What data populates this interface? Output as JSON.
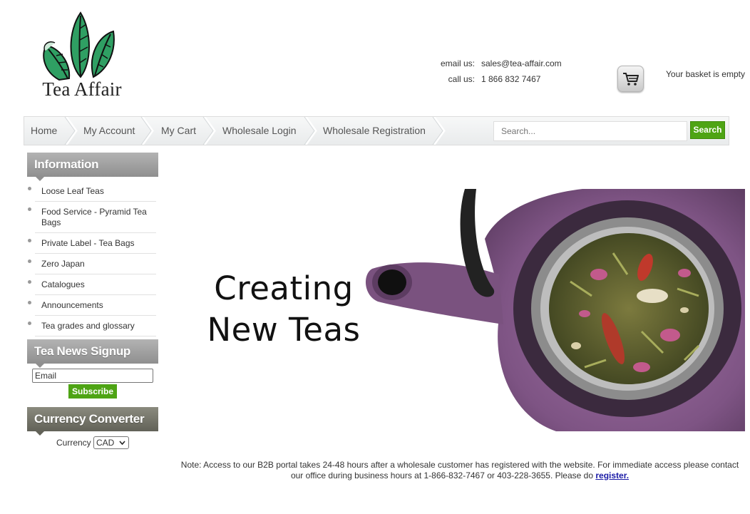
{
  "header": {
    "logo_text": "Tea Affair",
    "contact": [
      {
        "label": "email us:",
        "value": "sales@tea-affair.com"
      },
      {
        "label": "call us:",
        "value": "1 866 832 7467"
      }
    ],
    "basket_status": "Your basket is empty"
  },
  "nav": {
    "items": [
      "Home",
      "My Account",
      "My Cart",
      "Wholesale Login",
      "Wholesale Registration"
    ],
    "search_placeholder": "Search...",
    "search_button": "Search"
  },
  "sidebar": {
    "information": {
      "title": "Information",
      "items": [
        "Loose Leaf Teas",
        "Food Service - Pyramid Tea Bags",
        "Private Label - Tea Bags",
        "Zero Japan",
        "Catalogues",
        "Announcements",
        "Tea grades and glossary"
      ]
    },
    "newsletter": {
      "title": "Tea News Signup",
      "email_value": "Email",
      "subscribe_label": "Subscribe"
    },
    "currency": {
      "title": "Currency Converter",
      "label": "Currency",
      "selected": "CAD"
    }
  },
  "banner": {
    "line1": "Creating",
    "line2": "New Teas"
  },
  "note": {
    "text": "Note: Access to our B2B portal takes 24-48 hours after a wholesale customer has registered with the website. For immediate access please contact our office during business hours at 1-866-832-7467 or 403-228-3655. Please do ",
    "link": "register."
  },
  "colors": {
    "accent_green": "#4ea414",
    "header_gray": "#9e9e9e",
    "header_dark": "#707066",
    "teapot_purple": "#8a5f8f",
    "link_blue": "#1a1aa6"
  },
  "icons": [
    "tea-leaves-logo-icon",
    "shopping-cart-icon",
    "chevron-down-icon"
  ]
}
